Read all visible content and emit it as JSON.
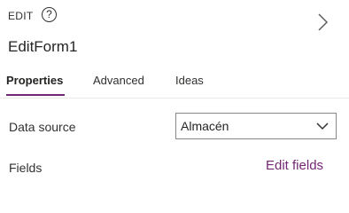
{
  "header": {
    "kind": "EDIT",
    "help_glyph": "?",
    "title": "EditForm1",
    "chevron_icon": "chevron-right-icon"
  },
  "tabs": [
    {
      "label": "Properties",
      "active": true
    },
    {
      "label": "Advanced",
      "active": false
    },
    {
      "label": "Ideas",
      "active": false
    }
  ],
  "properties": {
    "data_source_label": "Data source",
    "data_source_value": "Almacén",
    "fields_label": "Fields",
    "edit_fields_link": "Edit fields"
  },
  "colors": {
    "accent": "#742774",
    "text": "#323130",
    "border": "#8a8886"
  }
}
